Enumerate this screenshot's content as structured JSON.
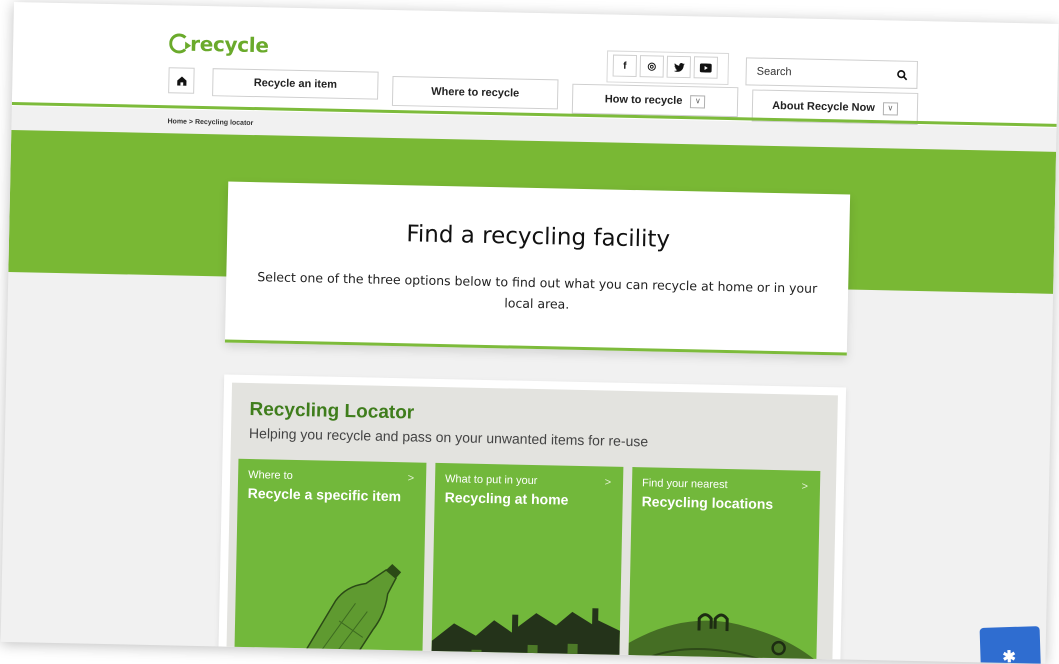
{
  "brand": {
    "logo_text": "recycle",
    "accent": "#7dbb3b",
    "dark_green": "#3f7d1c"
  },
  "nav": {
    "home_icon": "home-icon",
    "items": [
      {
        "label": "Recycle an item"
      },
      {
        "label": "Where to recycle"
      },
      {
        "label": "How to recycle"
      },
      {
        "label": "About Recycle Now"
      }
    ]
  },
  "social": [
    "f",
    "◎",
    "▾",
    "▶"
  ],
  "search": {
    "placeholder": "Search",
    "icon": "search-icon"
  },
  "breadcrumb": {
    "home": "Home",
    "separator": ">",
    "current": "Recycling locator"
  },
  "hero": {
    "title": "Find a recycling facility",
    "description": "Select one of the three options below to find out what you can recycle at home or in your local area."
  },
  "locator": {
    "title": "Recycling Locator",
    "subtitle": "Helping you recycle and pass on your unwanted items for re-use",
    "cards": [
      {
        "kicker": "Where to",
        "title": "Recycle a specific item"
      },
      {
        "kicker": "What to put in your",
        "title": "Recycling at home"
      },
      {
        "kicker": "Find your nearest",
        "title": "Recycling locations"
      }
    ],
    "chevron": ">"
  }
}
